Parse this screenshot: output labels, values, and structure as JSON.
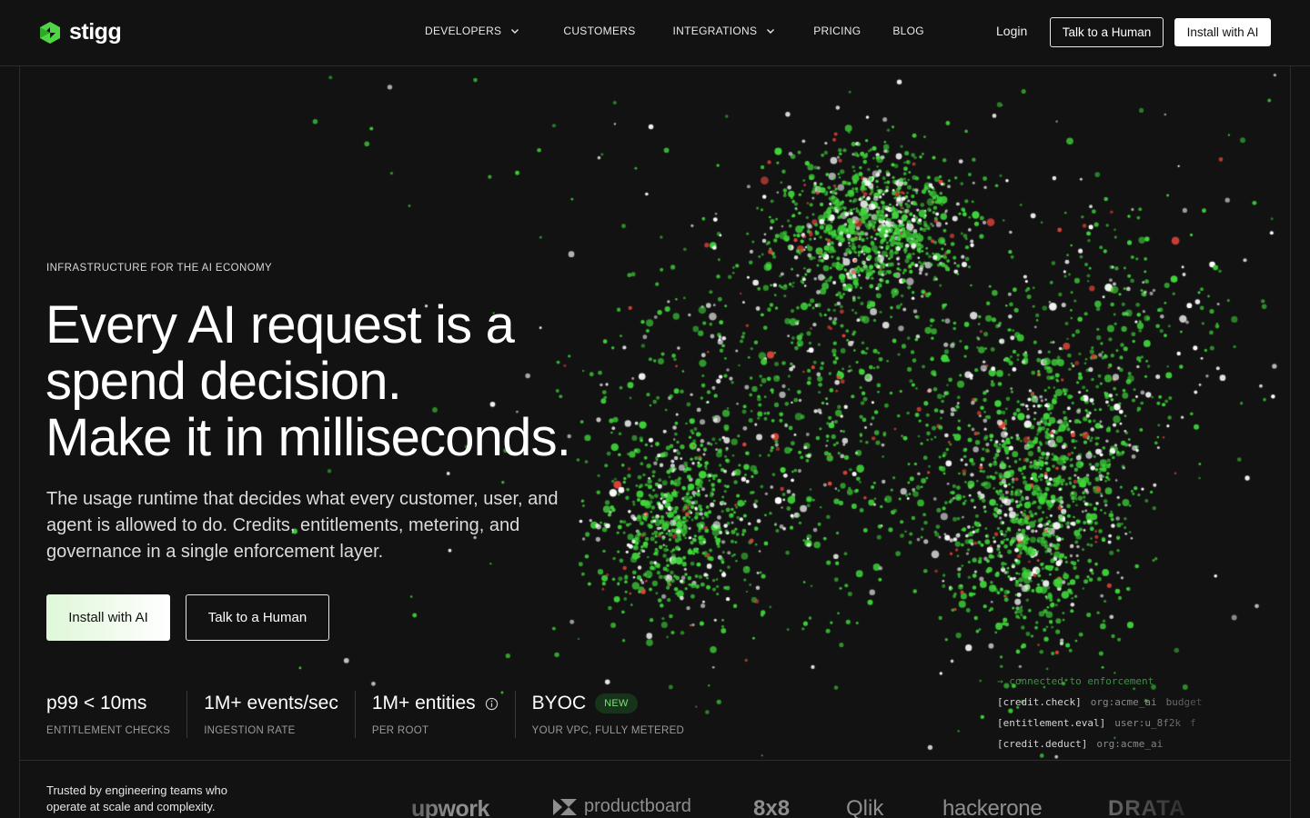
{
  "brand": {
    "name": "stigg",
    "accent": "#4fd645"
  },
  "nav": {
    "items": [
      {
        "label": "DEVELOPERS",
        "has_dropdown": true
      },
      {
        "label": "CUSTOMERS",
        "has_dropdown": false
      },
      {
        "label": "INTEGRATIONS",
        "has_dropdown": true
      },
      {
        "label": "PRICING",
        "has_dropdown": false
      },
      {
        "label": "BLOG",
        "has_dropdown": false
      }
    ],
    "login": "Login",
    "talk_button": "Talk to a Human",
    "install_button": "Install with AI"
  },
  "hero": {
    "eyebrow": "INFRASTRUCTURE FOR THE AI ECONOMY",
    "headline": [
      "Every AI request is a",
      "spend decision.",
      "Make it in milliseconds."
    ],
    "subhead": "The usage runtime that decides what every customer, user, and agent is allowed to do. Credits, entitlements, metering, and governance in a single enforcement layer.",
    "primary_cta": "Install with AI",
    "secondary_cta": "Talk to a Human"
  },
  "stats": [
    {
      "value": "p99 < 10ms",
      "label": "ENTITLEMENT CHECKS"
    },
    {
      "value": "1M+ events/sec",
      "label": "INGESTION RATE"
    },
    {
      "value": "1M+ entities",
      "label": "PER ROOT",
      "icon": "info-icon"
    },
    {
      "value": "BYOC",
      "label": "YOUR VPC, FULLY METERED",
      "badge": "NEW"
    }
  ],
  "terminal": {
    "status": "→ connected to enforcement",
    "lines": [
      {
        "cmd": "[credit.check]",
        "arg1": "org:acme_ai",
        "arg2": "budget"
      },
      {
        "cmd": "[entitlement.eval]",
        "arg1": "user:u_8f2k",
        "arg2": "f"
      },
      {
        "cmd": "[credit.deduct]",
        "arg1": "org:acme_ai",
        "arg2": ""
      }
    ]
  },
  "trusted": {
    "text": "Trusted by engineering teams who operate at scale and complexity.",
    "logos": [
      "upwork",
      "productboard",
      "8x8",
      "Qlik",
      "hackerone",
      "DRATA"
    ]
  },
  "colors": {
    "background": "#121212",
    "particle_green": "#3fd63a",
    "particle_white": "#ffffff",
    "particle_red": "#e0453a"
  }
}
